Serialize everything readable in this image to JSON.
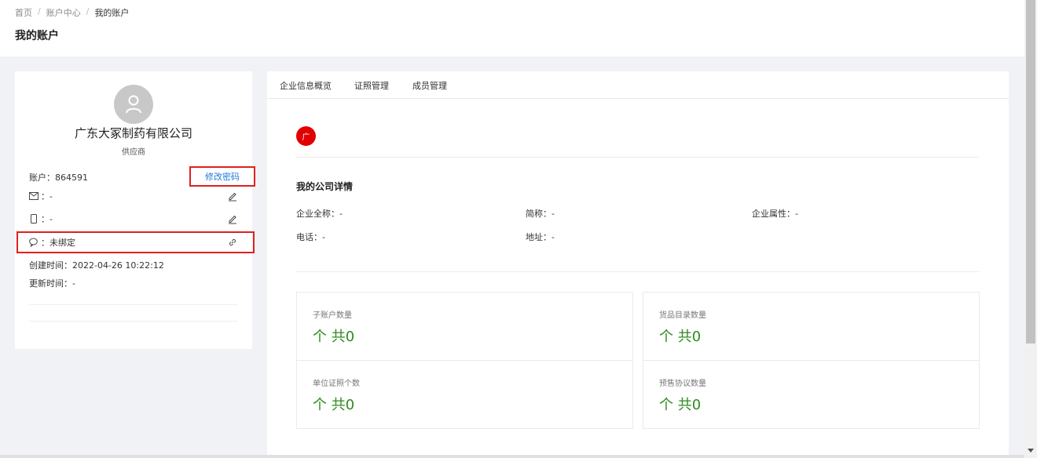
{
  "breadcrumb": {
    "home": "首页",
    "account_center": "账户中心",
    "current": "我的账户"
  },
  "page_title": "我的账户",
  "profile": {
    "company_name": "广东大冢制药有限公司",
    "company_type": "供应商",
    "account_label": "账户：864591",
    "change_password": "修改密码",
    "email_value": "：-",
    "phone_value": "：-",
    "wechat_value": "：未绑定",
    "created_at": "创建时间：2022-04-26 10:22:12",
    "updated_at": "更新时间：-",
    "icons": {
      "avatar": "user-icon",
      "email": "mail-icon",
      "phone": "phone-icon",
      "wechat": "chat-icon",
      "edit": "pencil-icon",
      "link": "link-icon"
    }
  },
  "tabs": [
    "企业信息概览",
    "证照管理",
    "成员管理"
  ],
  "company": {
    "logo_char": "广",
    "section_title": "我的公司详情",
    "full_name": "企业全称：-",
    "short_name": "简称：-",
    "attribute": "企业属性：-",
    "phone": "电话：-",
    "address": "地址：-"
  },
  "stats": [
    {
      "label": "子账户数量",
      "value": "个 共0"
    },
    {
      "label": "货品目录数量",
      "value": "个 共0"
    },
    {
      "label": "单位证照个数",
      "value": "个 共0"
    },
    {
      "label": "预售协议数量",
      "value": "个 共0"
    }
  ],
  "colors": {
    "accent_link": "#1f7adb",
    "highlight_border": "#e02020",
    "stat_value": "#2e8b1e",
    "logo_bg": "#e00000"
  }
}
